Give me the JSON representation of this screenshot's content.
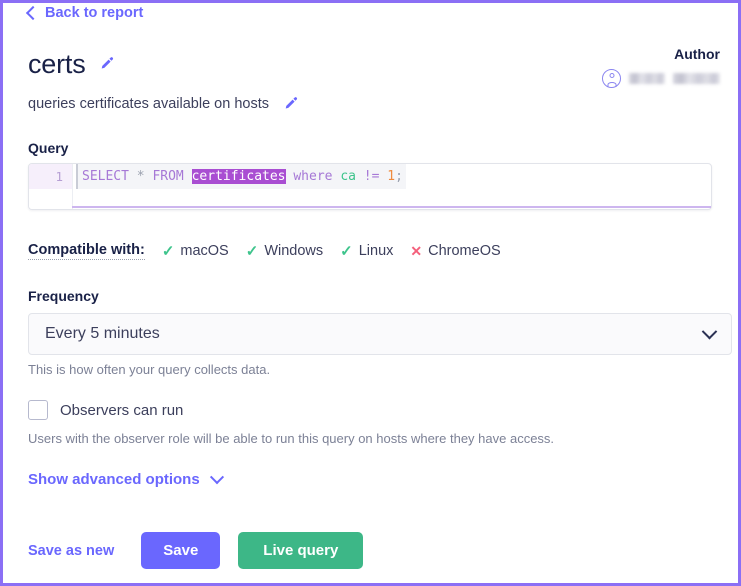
{
  "nav": {
    "back_label": "Back to report",
    "back_icon": "chevron-left-icon"
  },
  "author": {
    "title": "Author",
    "avatar_icon": "user-circle-icon",
    "name_redacted": true
  },
  "query": {
    "name": "certs",
    "name_edit_icon": "pencil-icon",
    "description": "queries certificates available on hosts",
    "description_edit_icon": "pencil-icon",
    "section_label": "Query",
    "line_number": "1",
    "sql_tokens": [
      {
        "text": "SELECT",
        "type": "keyword"
      },
      {
        "text": " ",
        "type": "plain"
      },
      {
        "text": "*",
        "type": "operator"
      },
      {
        "text": " ",
        "type": "plain"
      },
      {
        "text": "FROM",
        "type": "keyword"
      },
      {
        "text": " ",
        "type": "plain"
      },
      {
        "text": "certificates",
        "type": "selection"
      },
      {
        "text": " ",
        "type": "plain"
      },
      {
        "text": "where",
        "type": "keyword"
      },
      {
        "text": " ",
        "type": "plain"
      },
      {
        "text": "ca",
        "type": "column"
      },
      {
        "text": " ",
        "type": "plain"
      },
      {
        "text": "!=",
        "type": "keyword"
      },
      {
        "text": " ",
        "type": "plain"
      },
      {
        "text": "1",
        "type": "number"
      },
      {
        "text": ";",
        "type": "punctuation"
      }
    ],
    "sql_plain": "SELECT * FROM certificates where ca != 1;"
  },
  "compatibility": {
    "label": "Compatible with:",
    "platforms": [
      {
        "name": "macOS",
        "supported": true,
        "icon": "check-icon"
      },
      {
        "name": "Windows",
        "supported": true,
        "icon": "check-icon"
      },
      {
        "name": "Linux",
        "supported": true,
        "icon": "check-icon"
      },
      {
        "name": "ChromeOS",
        "supported": false,
        "icon": "cross-icon"
      }
    ]
  },
  "frequency": {
    "label": "Frequency",
    "selected": "Every 5 minutes",
    "chevron_icon": "chevron-down-icon",
    "help": "This is how often your query collects data."
  },
  "observers": {
    "label": "Observers can run",
    "checked": false,
    "help": "Users with the observer role will be able to run this query on hosts where they have access."
  },
  "advanced": {
    "label": "Show advanced options",
    "chevron_icon": "chevron-down-icon",
    "expanded": false
  },
  "actions": {
    "save_as_new": "Save as new",
    "save": "Save",
    "live_query": "Live query"
  },
  "colors": {
    "accent_purple": "#6a67fe",
    "page_border": "#8b6ff5",
    "success_green": "#3ec48c",
    "button_green": "#3db787",
    "danger_red": "#f4607c",
    "text_dark": "#192147",
    "text_body": "#3c3f5c",
    "text_muted": "#7c8196",
    "sql_keyword": "#a678d6",
    "sql_selection_bg": "#a94ed2",
    "sql_column": "#3ec48c",
    "sql_number": "#ef8a3d"
  }
}
